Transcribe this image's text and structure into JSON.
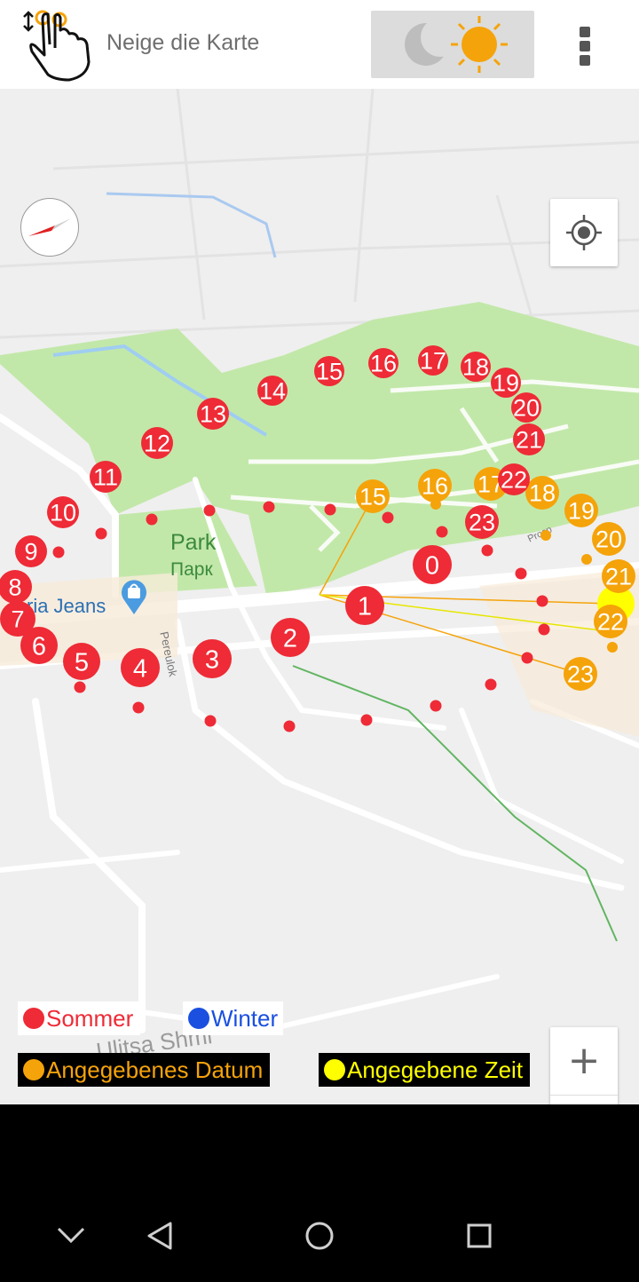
{
  "header": {
    "title": "Neige die Karte"
  },
  "map": {
    "park_label": "Park",
    "park_label_ru": "Парк",
    "shop_label": "ria Jeans",
    "street_label": "Ulitsa Shmi",
    "side_street_label": "Pereulok",
    "side_street_label2": "Prosp"
  },
  "markers": {
    "summer": [
      "0",
      "1",
      "2",
      "3",
      "4",
      "5",
      "6",
      "7",
      "8",
      "9",
      "10",
      "11",
      "12",
      "13",
      "14",
      "15",
      "16",
      "17",
      "18",
      "19",
      "20",
      "21",
      "22",
      "23"
    ],
    "date": [
      "15",
      "16",
      "17",
      "18",
      "19",
      "20",
      "21",
      "22",
      "23"
    ]
  },
  "legend": {
    "summer": "Sommer",
    "winter": "Winter",
    "date": "Angegebenes Datum",
    "time": "Angegebene Zeit"
  },
  "zoom": {
    "plus": "+",
    "minus": "−"
  },
  "colors": {
    "summer": "#ee2b36",
    "winter": "#1a4fe0",
    "date": "#f5a30a",
    "time": "#ffff00",
    "park": "#c2e8a9"
  },
  "icons": [
    "hand-tilt-icon",
    "moon-icon",
    "sun-icon",
    "menu-icon",
    "compass-icon",
    "my-location-icon",
    "shopping-bag-icon",
    "back-icon",
    "home-icon",
    "recents-icon",
    "hide-keyboard-icon"
  ]
}
